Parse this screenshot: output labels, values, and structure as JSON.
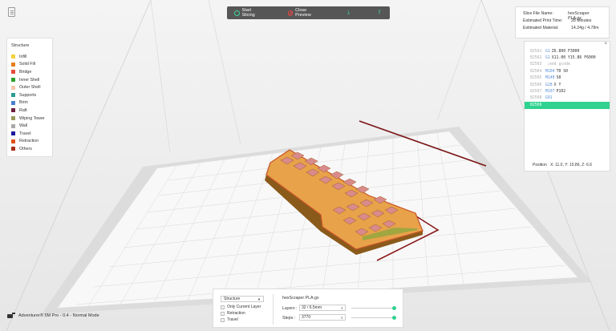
{
  "app": {
    "status_text": "Adventurer® 5M Pro - 0.4 - Normal Mode"
  },
  "toolbar": {
    "start_label": "Start Slicing",
    "close_label": "Close Preview",
    "icon_upload": "download-icon",
    "icon_print": "print-icon"
  },
  "legend": {
    "title": "Structure",
    "items": [
      {
        "label": "Infill",
        "color": "#f4d03f"
      },
      {
        "label": "Solid Fill",
        "color": "#e67e22"
      },
      {
        "label": "Bridge",
        "color": "#e74c3c"
      },
      {
        "label": "Inner Shell",
        "color": "#2e9e2e"
      },
      {
        "label": "Outer Shell",
        "color": "#f5c6a8"
      },
      {
        "label": "Supports",
        "color": "#2a9d8f"
      },
      {
        "label": "Brim",
        "color": "#4a7fd4"
      },
      {
        "label": "Raft",
        "color": "#6b1f3c"
      },
      {
        "label": "Wiping Tower",
        "color": "#9a9a5a"
      },
      {
        "label": "Wall",
        "color": "#a8a8a8"
      },
      {
        "label": "Travel",
        "color": "#1a1a9e"
      },
      {
        "label": "Retraction",
        "color": "#e0521a"
      },
      {
        "label": "Others",
        "color": "#a8321a"
      }
    ]
  },
  "info": {
    "rows": [
      {
        "key": "Slice File Name:",
        "value": "hexScraper PLA.gx"
      },
      {
        "key": "Estimated Print Time:",
        "value": "28 Minutes"
      },
      {
        "key": "Estimated Material:",
        "value": "14.24g / 4.78m"
      }
    ]
  },
  "gcode": {
    "lines": [
      {
        "ln": "82561",
        "cmd": "G1",
        "arg": "Z6.800 F3000",
        "type": "normal"
      },
      {
        "ln": "82562",
        "cmd": "G1",
        "arg": "X11.00 Y15.86 F6000",
        "type": "normal"
      },
      {
        "ln": "82563",
        "cmd": "",
        "arg": ";end gcode",
        "type": "cmt"
      },
      {
        "ln": "82564",
        "cmd": "M104",
        "arg": "T0 S0",
        "type": "normal"
      },
      {
        "ln": "82565",
        "cmd": "M140",
        "arg": "S0",
        "type": "normal"
      },
      {
        "ln": "82566",
        "cmd": "G28",
        "arg": "X Y",
        "type": "normal"
      },
      {
        "ln": "82567",
        "cmd": "M107",
        "arg": "P102",
        "type": "normal"
      },
      {
        "ln": "82568",
        "cmd": "G91",
        "arg": "",
        "type": "normal"
      },
      {
        "ln": "82569",
        "cmd": "",
        "arg": "",
        "type": "sel"
      }
    ],
    "position_label": "Position",
    "position_value": "X: 11.0, Y: 15.86, Z: 6.6"
  },
  "bottom": {
    "mode_select": "Structure",
    "checkboxes": [
      "Only Current Layer",
      "Retraction",
      "Travel"
    ],
    "file_name": "hexScraper PLA.gx",
    "layers_label": "Layers :",
    "layers_value": "32 / 6.5mm",
    "steps_label": "Steps :",
    "steps_value": "3770",
    "layers_fill": 1.0,
    "steps_fill": 1.0
  }
}
